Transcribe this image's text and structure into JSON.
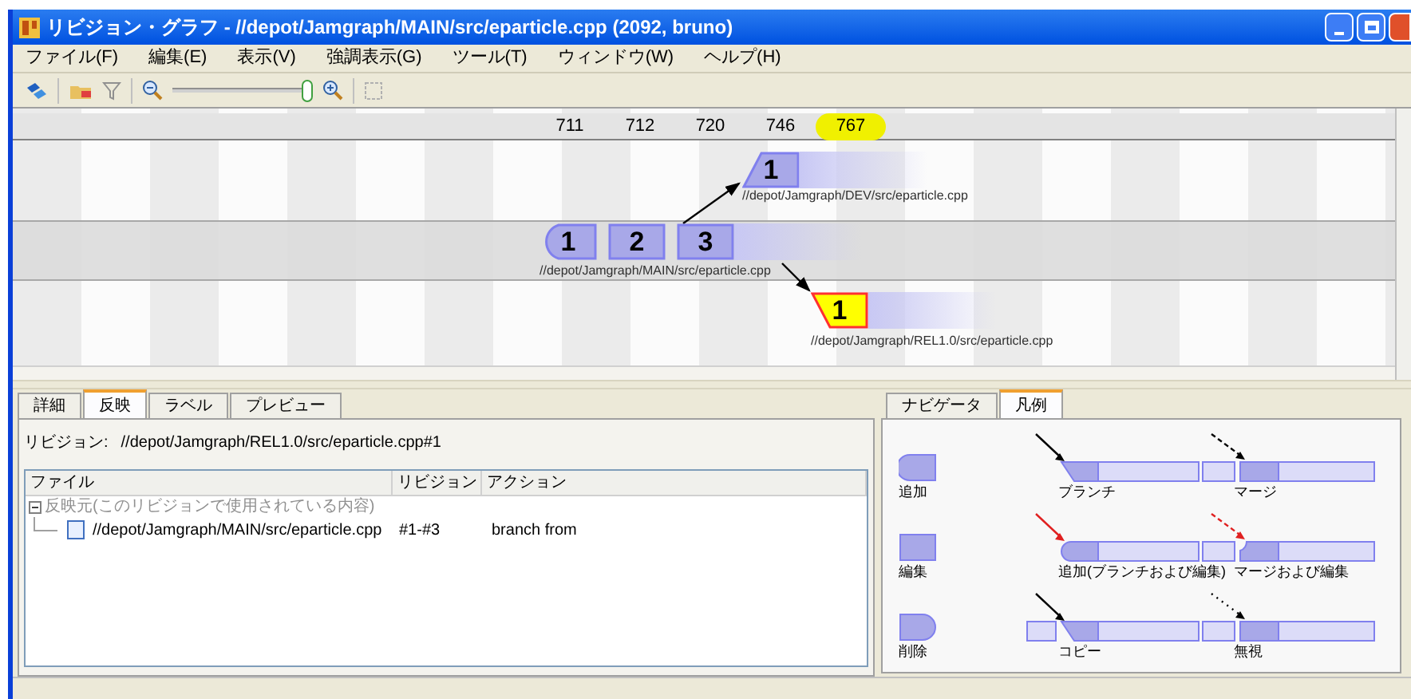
{
  "window": {
    "title": "リビジョン・グラフ - //depot/Jamgraph/MAIN/src/eparticle.cpp (2092, bruno)"
  },
  "menu": [
    "ファイル(F)",
    "編集(E)",
    "表示(V)",
    "強調表示(G)",
    "ツール(T)",
    "ウィンドウ(W)",
    "ヘルプ(H)"
  ],
  "toolbar": {
    "zoom": {
      "level": 1
    }
  },
  "graph": {
    "changelists": [
      {
        "label": "711",
        "selected": false
      },
      {
        "label": "712",
        "selected": false
      },
      {
        "label": "720",
        "selected": false
      },
      {
        "label": "746",
        "selected": false
      },
      {
        "label": "767",
        "selected": true
      }
    ],
    "branches": [
      {
        "path": "//depot/Jamgraph/DEV/src/eparticle.cpp",
        "revisions": [
          {
            "label": "1",
            "kind": "branch",
            "selected": false
          }
        ]
      },
      {
        "path": "//depot/Jamgraph/MAIN/src/eparticle.cpp",
        "revisions": [
          {
            "label": "1",
            "kind": "add",
            "selected": false
          },
          {
            "label": "2",
            "kind": "edit",
            "selected": false
          },
          {
            "label": "3",
            "kind": "edit",
            "selected": false
          }
        ]
      },
      {
        "path": "//depot/Jamgraph/REL1.0/src/eparticle.cpp",
        "revisions": [
          {
            "label": "1",
            "kind": "branch",
            "selected": true
          }
        ]
      }
    ]
  },
  "details": {
    "tabs": [
      {
        "label": "詳細",
        "selected": false
      },
      {
        "label": "反映",
        "selected": true
      },
      {
        "label": "ラベル",
        "selected": false
      },
      {
        "label": "プレビュー",
        "selected": false
      }
    ],
    "revision_label": "リビジョン:",
    "revision": "//depot/Jamgraph/REL1.0/src/eparticle.cpp#1",
    "columns": [
      "ファイル",
      "リビジョン",
      "アクション"
    ],
    "tree": [
      {
        "label": "反映元(このリビジョンで使用されている内容)",
        "expanded": true,
        "children": [
          {
            "file": "//depot/Jamgraph/MAIN/src/eparticle.cpp",
            "revision": "#1-#3",
            "action": "branch from"
          }
        ]
      }
    ]
  },
  "legend_panel": {
    "tabs": [
      {
        "label": "ナビゲータ",
        "selected": false
      },
      {
        "label": "凡例",
        "selected": true
      }
    ],
    "items": [
      {
        "label": "追加",
        "kind": "add"
      },
      {
        "label": "ブランチ",
        "kind": "branch"
      },
      {
        "label": "マージ",
        "kind": "merge"
      },
      {
        "label": "編集",
        "kind": "edit"
      },
      {
        "label": "追加(ブランチおよび編集)",
        "kind": "add_branch_edit"
      },
      {
        "label": "マージおよび編集",
        "kind": "merge_edit"
      },
      {
        "label": "削除",
        "kind": "delete"
      },
      {
        "label": "コピー",
        "kind": "copy"
      },
      {
        "label": "無視",
        "kind": "ignore"
      }
    ]
  }
}
